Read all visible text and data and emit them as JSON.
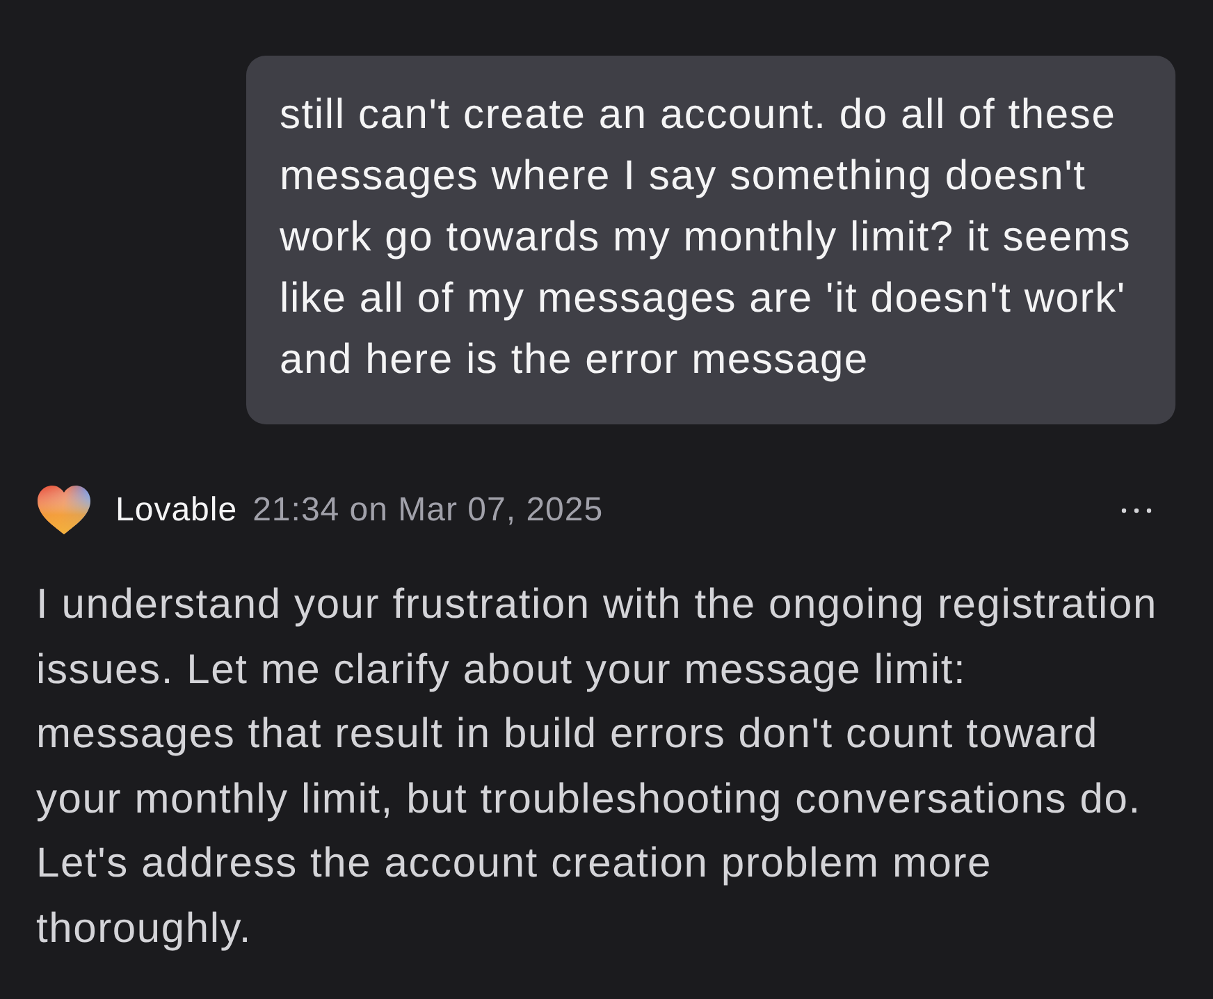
{
  "user_message": {
    "text": "still can't create an account. do all of these messages where I say something doesn't work go towards my monthly limit? it seems like all of my messages are 'it doesn't work' and here is the error message"
  },
  "assistant_message": {
    "author": "Lovable",
    "timestamp": "21:34 on Mar 07, 2025",
    "text": "I understand your frustration with the ongoing registration issues. Let me clarify about your message limit: messages that result in build errors don't count toward your monthly limit, but troubleshooting conversations do. Let's address the account creation problem more thoroughly."
  }
}
